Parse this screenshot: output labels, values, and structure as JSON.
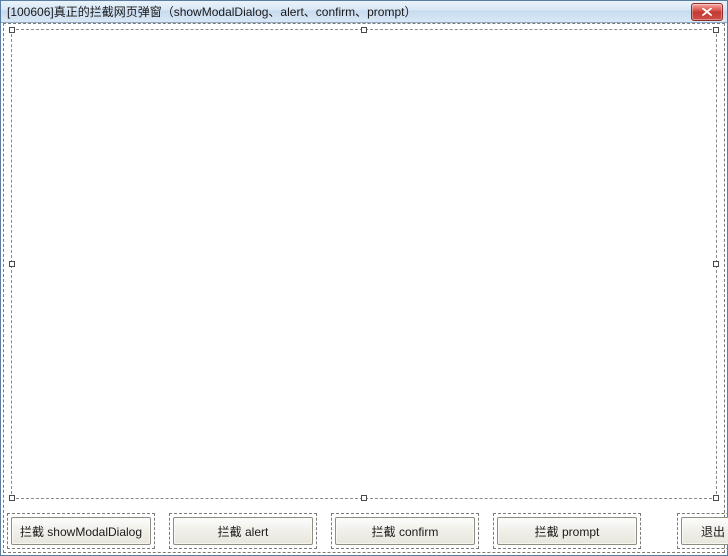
{
  "window": {
    "title": "[100606]真正的拦截网页弹窗（showModalDialog、alert、confirm、prompt）"
  },
  "buttons": {
    "b1": "拦截 showModalDialog",
    "b2": "拦截 alert",
    "b3": "拦截 confirm",
    "b4": "拦截 prompt",
    "exit": "退出"
  }
}
